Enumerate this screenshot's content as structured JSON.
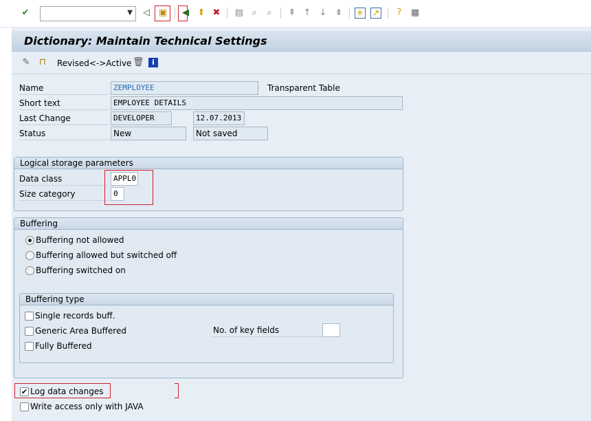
{
  "toolbar": {
    "command_field": "",
    "icons": [
      "enter-check",
      "back-triangle",
      "save",
      "back",
      "exit",
      "cancel",
      "print",
      "find",
      "find-next",
      "first-page",
      "prev-page",
      "next-page",
      "last-page",
      "new-session",
      "shortcut",
      "help",
      "customize-layout"
    ]
  },
  "title": "Dictionary: Maintain Technical Settings",
  "app_toolbar": {
    "revised_active": "Revised<->Active"
  },
  "header": {
    "name_label": "Name",
    "name_value": "ZEMPLOYEE",
    "table_type": "Transparent Table",
    "short_text_label": "Short text",
    "short_text_value": "EMPLOYEE DETAILS",
    "last_change_label": "Last Change",
    "last_change_user": "DEVELOPER",
    "last_change_date": "12.07.2013",
    "status_label": "Status",
    "status_value": "New",
    "save_status": "Not saved"
  },
  "logical_storage": {
    "title": "Logical storage parameters",
    "data_class_label": "Data class",
    "data_class": "APPL0",
    "size_category_label": "Size category",
    "size_category": "0"
  },
  "buffering": {
    "title": "Buffering",
    "options": [
      {
        "label": "Buffering not allowed",
        "selected": true
      },
      {
        "label": "Buffering allowed but switched off",
        "selected": false
      },
      {
        "label": "Buffering switched on",
        "selected": false
      }
    ],
    "type": {
      "title": "Buffering type",
      "single": "Single records buff.",
      "generic": "Generic Area Buffered",
      "full": "Fully Buffered",
      "key_fields_label": "No. of key fields",
      "key_fields": ""
    }
  },
  "log_data_changes": {
    "label": "Log data changes",
    "checked": true
  },
  "write_java": {
    "label": "Write access only with JAVA",
    "checked": false
  }
}
